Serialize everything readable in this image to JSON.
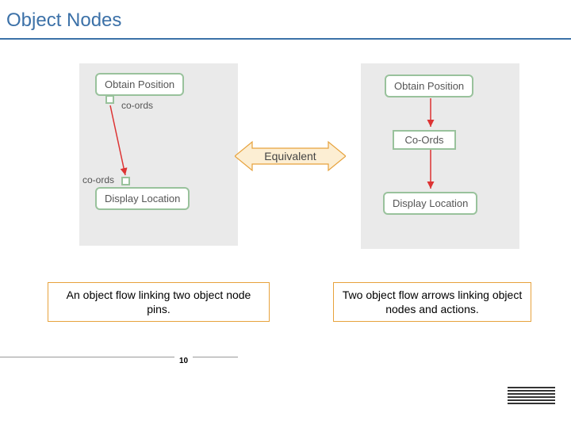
{
  "title": "Object Nodes",
  "left": {
    "action1": "Obtain Position",
    "action2": "Display Location",
    "pinLabel1": "co-ords",
    "pinLabel2": "co-ords"
  },
  "right": {
    "action1": "Obtain Position",
    "object": "Co-Ords",
    "action2": "Display Location"
  },
  "equivalent": "Equivalent",
  "captionLeft": "An object flow linking two object node pins.",
  "captionRight": "Two object flow arrows linking object nodes and actions.",
  "pageNumber": "10",
  "logo": "IBM"
}
